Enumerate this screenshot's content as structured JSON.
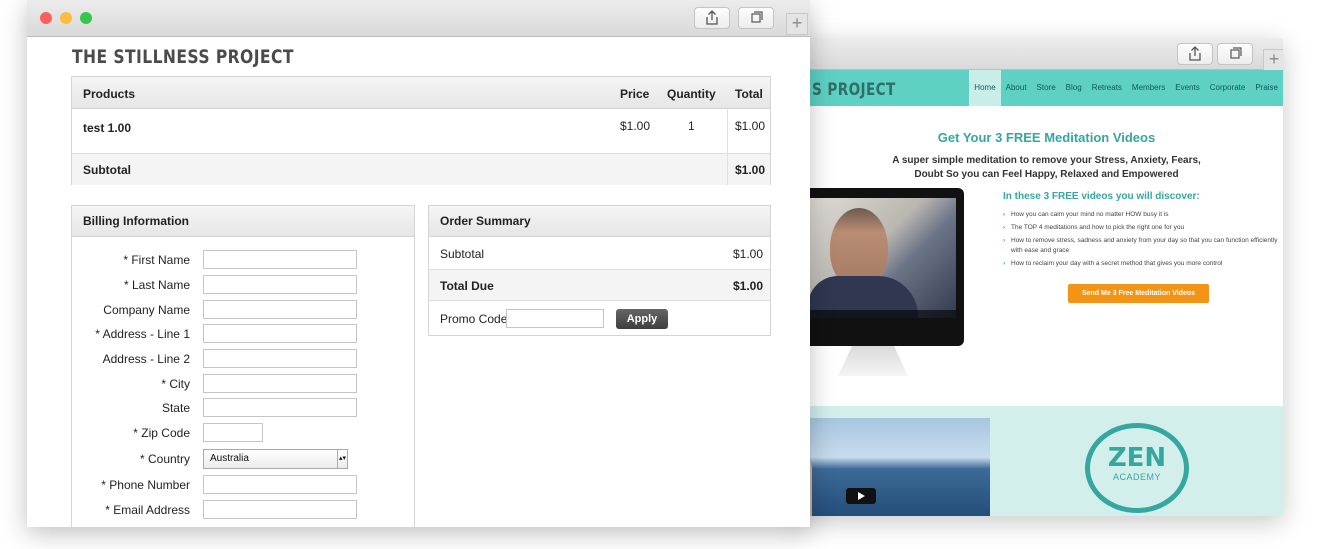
{
  "back_site": {
    "brand": "S PROJECT",
    "nav": [
      "Home",
      "About",
      "Store",
      "Blog",
      "Retreats",
      "Members",
      "Events",
      "Corporate",
      "Praise"
    ],
    "headline": "Get Your 3 FREE Meditation Videos",
    "subhead_line1": "A super simple meditation to remove  your Stress, Anxiety, Fears,",
    "subhead_line2": "Doubt So you can Feel Happy, Relaxed and Empowered",
    "discover_title": "In these 3 FREE videos you will discover:",
    "bullets": [
      "How you can calm your mind no matter HOW busy it is",
      "The TOP 4 meditations and how to pick the right one for you",
      "How to remove stress, sadness and anxiety from your day so that you can function efficiently with ease and grace",
      "How to reclaim your day with a secret method that gives you more control"
    ],
    "cta": "Send Me 3 Free Meditation Videos",
    "zen_word": "ZEN",
    "zen_sub": "ACADEMY",
    "plus": "+"
  },
  "front": {
    "brand": "THE STILLNESS PROJECT",
    "plus": "+",
    "cart": {
      "headers": {
        "product": "Products",
        "price": "Price",
        "quantity": "Quantity",
        "total": "Total"
      },
      "item": {
        "name": "test 1.00",
        "price": "$1.00",
        "quantity": "1",
        "total": "$1.00"
      },
      "subtotal_label": "Subtotal",
      "subtotal_value": "$1.00"
    },
    "billing": {
      "title": "Billing Information",
      "fields": {
        "first_name": "* First Name",
        "last_name": "* Last Name",
        "company": "Company Name",
        "address1": "* Address - Line 1",
        "address2": "Address - Line 2",
        "city": "* City",
        "state": "State",
        "zip": "* Zip Code",
        "country": "* Country",
        "phone": "* Phone Number",
        "email": "* Email Address"
      },
      "country_value": "Australia"
    },
    "summary": {
      "title": "Order Summary",
      "subtotal_label": "Subtotal",
      "subtotal_value": "$1.00",
      "total_label": "Total Due",
      "total_value": "$1.00",
      "promo_label": "Promo Code:",
      "apply": "Apply"
    }
  },
  "colors": {
    "teal": "#35a6a0",
    "teal_header": "#5ed0c4",
    "cta_orange": "#f39416",
    "close": "#fc605c",
    "minimize": "#fdbc40",
    "zoom": "#34c84a"
  }
}
